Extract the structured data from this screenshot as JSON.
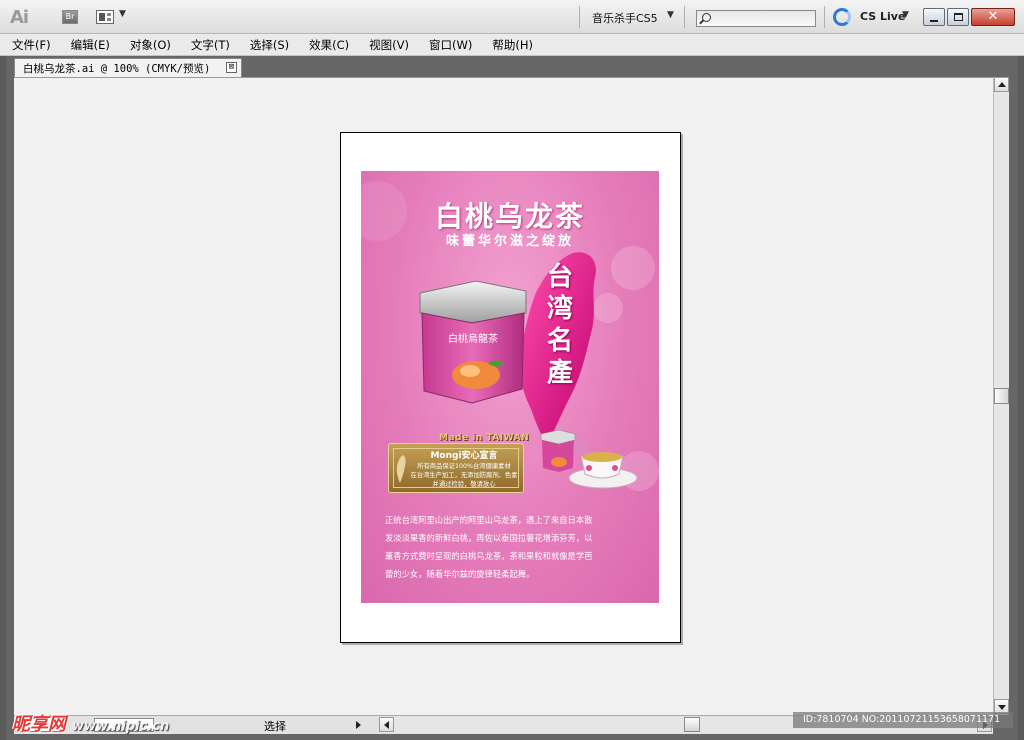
{
  "app": {
    "logo": "Ai",
    "bridge_label": "Br",
    "workspace": "音乐杀手CS5",
    "search_placeholder": "",
    "cslive_label": "CS Live"
  },
  "menu": [
    "文件(F)",
    "编辑(E)",
    "对象(O)",
    "文字(T)",
    "选择(S)",
    "效果(C)",
    "视图(V)",
    "窗口(W)",
    "帮助(H)"
  ],
  "document": {
    "tab_title": "白桃乌龙茶.ai @ 100% (CMYK/预览)",
    "tab_close": "⊠"
  },
  "poster": {
    "title": "白桃乌龙茶",
    "subtitle": "味蕾华尔滋之绽放",
    "map_text": [
      "台",
      "湾",
      "名",
      "產"
    ],
    "made_in": "Made in TAIWAN",
    "badge_title": "Mongi安心宣言",
    "badge_lines": [
      "所有商品保证100%台湾健康素材",
      "在台湾生产加工，无添加防腐剂、色素",
      "并通过检验，敬请放心"
    ],
    "body": [
      "正统台湾阿里山出产的阿里山乌龙茶，遇上了来自日本散",
      "发淡淡果香的新鲜白桃，再佐以泰国拉薯花增添芬芳，以",
      "薰香方式费时呈现的白桃乌龙茶，茶和果粒和就像是学芭",
      "蕾的少女，随着华尔兹的旋律轻柔起舞。"
    ]
  },
  "status": {
    "zoom": "",
    "tool": "选择"
  },
  "watermark": {
    "site": "昵享网",
    "url": "www.nipic.cn",
    "id_text": "ID:7810704 NO:20110721153658071171"
  },
  "colors": {
    "poster_pink": "#e57cba",
    "badge_gold": "#b08a3e",
    "close_red": "#c7402e"
  }
}
